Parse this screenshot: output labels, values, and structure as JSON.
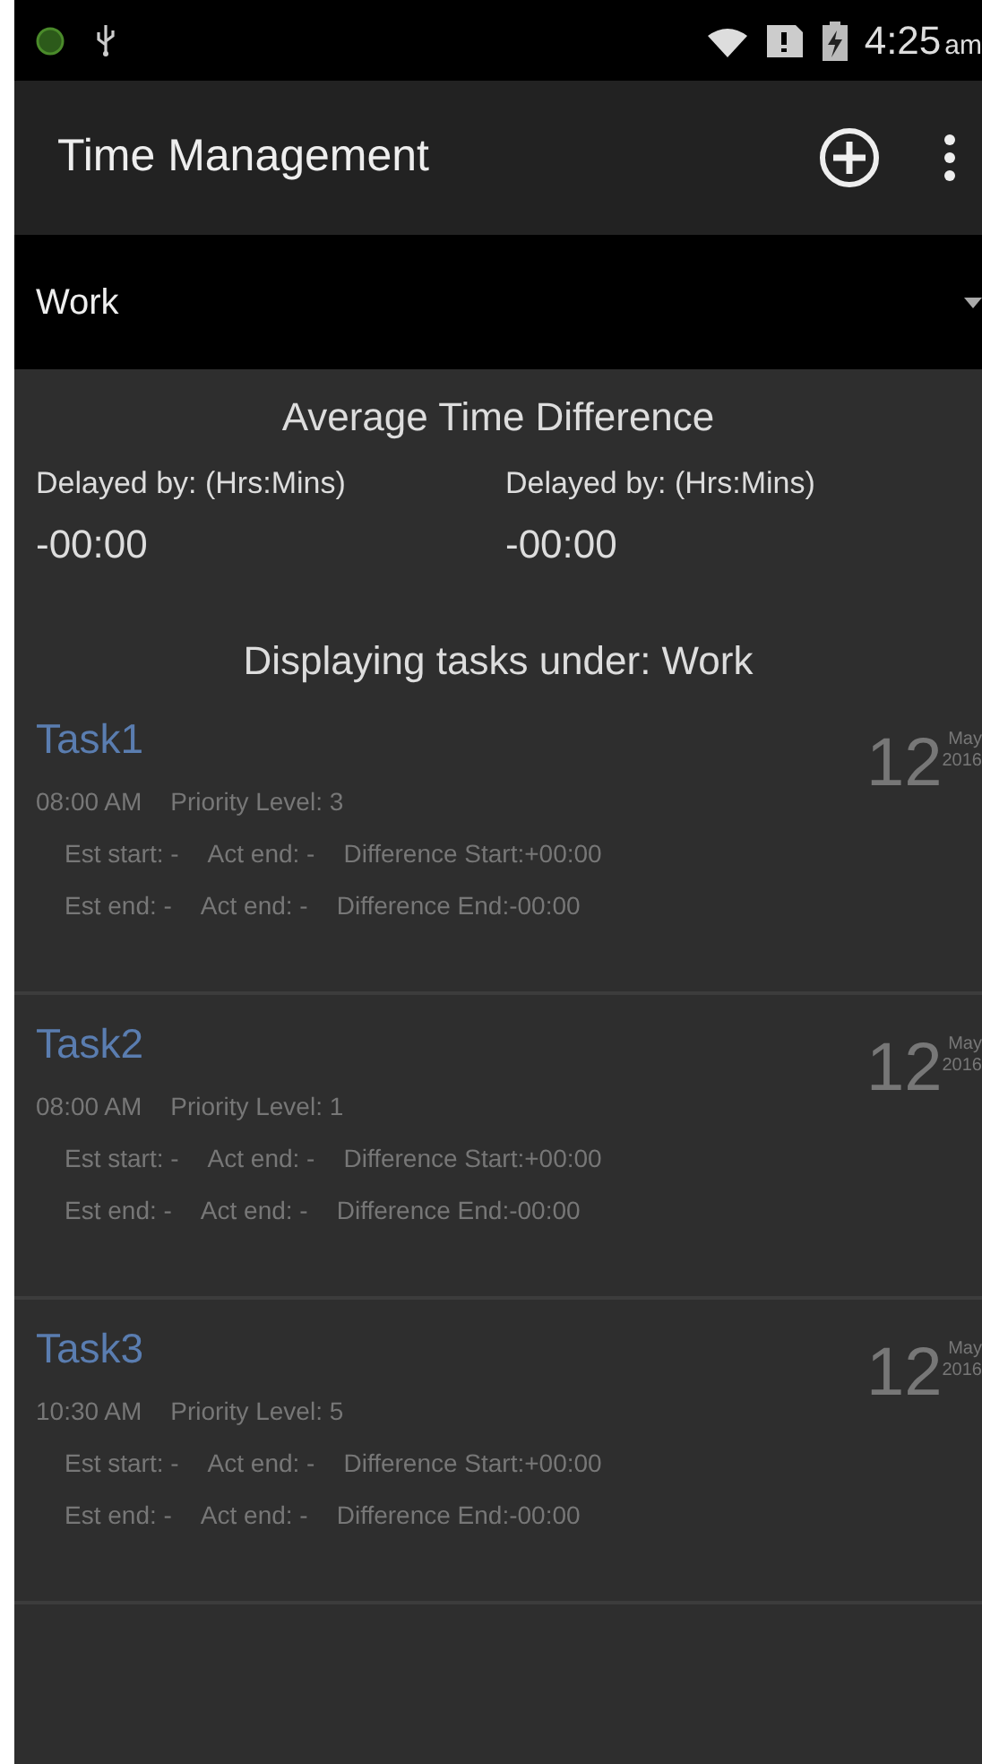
{
  "status_bar": {
    "time": "4:25",
    "ampm": "am"
  },
  "app_bar": {
    "title": "Time Management"
  },
  "category_spinner": {
    "value": "Work"
  },
  "summary": {
    "heading": "Average Time Difference",
    "columns": [
      {
        "label": "Delayed by: (Hrs:Mins)",
        "value": "-00:00"
      },
      {
        "label": "Delayed by: (Hrs:Mins)",
        "value": "-00:00"
      }
    ]
  },
  "list_heading": "Displaying tasks under: Work",
  "tasks": [
    {
      "title": "Task1",
      "time": "08:00 AM",
      "priority": "Priority Level: 3",
      "day": "12",
      "month": "May",
      "year": "2016",
      "est_start": "Est start: -",
      "act_end_1": "Act end: -",
      "diff_start": "Difference Start:+00:00",
      "est_end": "Est end: -",
      "act_end_2": "Act end: -",
      "diff_end": "Difference End:-00:00"
    },
    {
      "title": "Task2",
      "time": "08:00 AM",
      "priority": "Priority Level: 1",
      "day": "12",
      "month": "May",
      "year": "2016",
      "est_start": "Est start: -",
      "act_end_1": "Act end: -",
      "diff_start": "Difference Start:+00:00",
      "est_end": "Est end: -",
      "act_end_2": "Act end: -",
      "diff_end": "Difference End:-00:00"
    },
    {
      "title": "Task3",
      "time": "10:30 AM",
      "priority": "Priority Level: 5",
      "day": "12",
      "month": "May",
      "year": "2016",
      "est_start": "Est start: -",
      "act_end_1": "Act end: -",
      "diff_start": "Difference Start:+00:00",
      "est_end": "Est end: -",
      "act_end_2": "Act end: -",
      "diff_end": "Difference End:-00:00"
    }
  ]
}
